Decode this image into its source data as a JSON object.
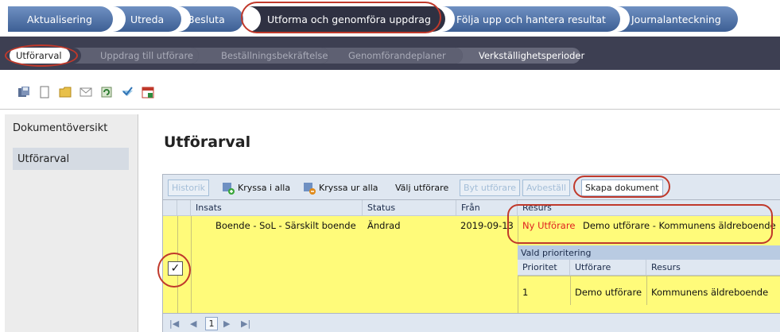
{
  "process_tabs": [
    {
      "label": "Aktualisering"
    },
    {
      "label": "Utreda"
    },
    {
      "label": "Besluta"
    },
    {
      "label": "Utforma och genomföra uppdrag"
    },
    {
      "label": "Följa upp och hantera resultat"
    },
    {
      "label": "Journalanteckning"
    }
  ],
  "sub_tabs": [
    {
      "label": "Utförarval"
    },
    {
      "label": "Uppdrag till utförare"
    },
    {
      "label": "Beställningsbekräftelse"
    },
    {
      "label": "Genomförandeplaner"
    },
    {
      "label": "Verkställighetsperioder"
    }
  ],
  "toolbar_icons": [
    "save-icon",
    "document-icon",
    "folder-icon",
    "envelope-icon",
    "refresh-icon",
    "checkmark-icon",
    "calendar-icon"
  ],
  "left_panel": {
    "title": "Dokumentöversikt",
    "items": [
      {
        "label": "Utförarval"
      }
    ]
  },
  "main": {
    "title": "Utförarval",
    "grid_toolbar": {
      "historik": "Historik",
      "kryssa_i_alla": "Kryssa i alla",
      "kryssa_ur_alla": "Kryssa ur alla",
      "valj_utforare": "Välj utförare",
      "byt_utforare": "Byt utförare",
      "avbestall": "Avbeställ",
      "skapa_dokument": "Skapa dokument"
    },
    "columns": [
      "Insats",
      "Status",
      "Från",
      "Resurs"
    ],
    "row": {
      "checked": "✓",
      "insats": "Boende - SoL - Särskilt boende",
      "status": "Ändrad",
      "fran": "2019-09-13",
      "resurs_new": "Ny Utförare",
      "resurs_name": "Demo utförare - Kommunens äldreboende"
    },
    "nested": {
      "title": "Vald prioritering",
      "columns": [
        "Prioritet",
        "Utförare",
        "Resurs"
      ],
      "row": {
        "prioritet": "1",
        "utforare": "Demo utförare",
        "resurs": "Kommunens äldreboende"
      }
    },
    "pager": {
      "first": "|◀",
      "prev": "◀",
      "page": "1",
      "next": "▶",
      "last": "▶|"
    }
  },
  "colors": {
    "active_tab": "#2f3142",
    "tab_blue": "#4a6fa5",
    "highlight_row": "#fffb7a",
    "annotation_red": "#c0392b",
    "new_resource_red": "#e02020"
  }
}
